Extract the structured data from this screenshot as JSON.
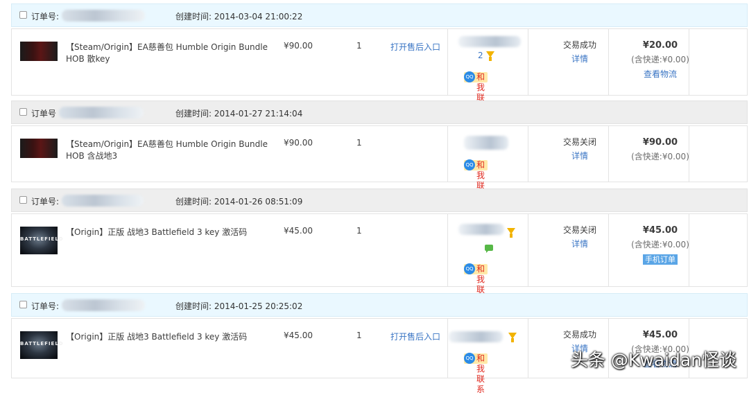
{
  "labels": {
    "order_no": "订单号:",
    "order_no_alt": "订单号",
    "created": "创建时间:",
    "after_sale": "打开售后入口",
    "contact": "和我联系",
    "detail": "详情",
    "logistics": "查看物流",
    "mobile_order": "手机订单"
  },
  "orders": [
    {
      "created": "2014-03-04 21:00:22",
      "title": "【Steam/Origin】EA慈善包 Humble Origin Bundle HOB 散key",
      "price": "¥90.00",
      "qty": "1",
      "seller_num": "2",
      "status": "交易成功",
      "total": "¥20.00",
      "shipping": "(含快递:¥0.00)"
    },
    {
      "created": "2014-01-27 21:14:04",
      "title": "【Steam/Origin】EA慈善包 Humble Origin Bundle HOB 含战地3",
      "price": "¥90.00",
      "qty": "1",
      "status": "交易关闭",
      "total": "¥90.00",
      "shipping": "(含快递:¥0.00)"
    },
    {
      "created": "2014-01-26 08:51:09",
      "title": "【Origin】正版 战地3 Battlefield 3 key 激活码",
      "price": "¥45.00",
      "qty": "1",
      "status": "交易关闭",
      "total": "¥45.00",
      "shipping": "(含快递:¥0.00)"
    },
    {
      "created": "2014-01-25 20:25:02",
      "title": "【Origin】正版 战地3 Battlefield 3 key 激活码",
      "price": "¥45.00",
      "qty": "1",
      "status": "交易成功",
      "total": "¥45.00",
      "shipping": "(含快递:¥0.00)"
    }
  ],
  "thumb_label": "BATTLEFIELD",
  "watermark": "头条 @Kwaidan怪谈",
  "colors": {
    "link": "#3a75c4",
    "header_blue": "#eaf8ff",
    "header_gray": "#eeeeee",
    "contact_bg": "#ffe9a8",
    "contact_text": "#e0281e",
    "funnel": "#f2b300",
    "mobile_badge": "#5aa5e6"
  },
  "icons": [
    "checkbox-icon",
    "qq-icon",
    "filter-funnel-icon",
    "wangwang-chat-icon"
  ]
}
